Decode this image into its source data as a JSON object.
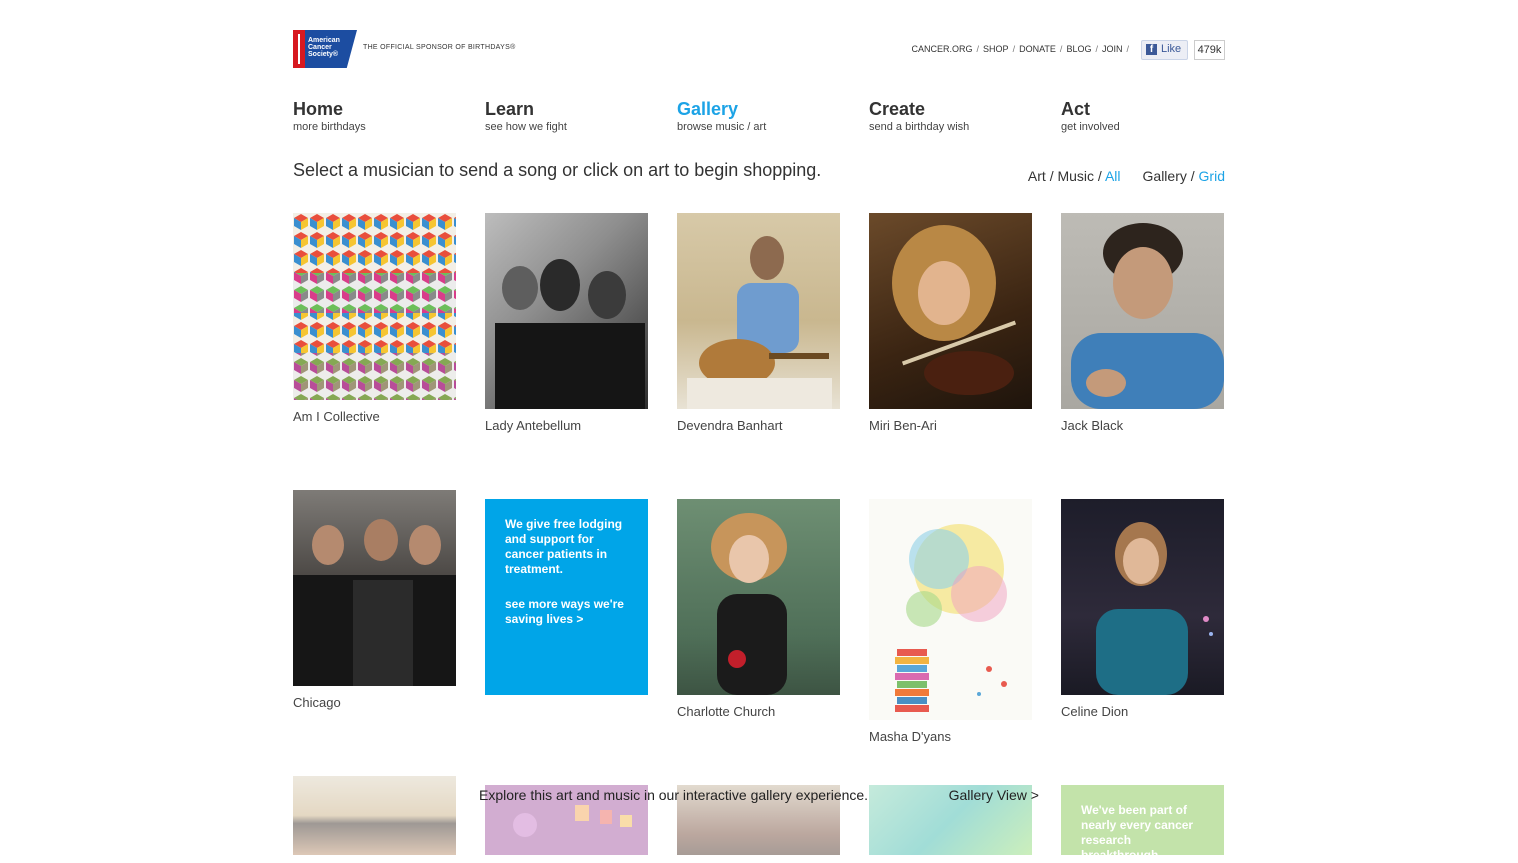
{
  "header": {
    "logo_lines": [
      "American",
      "Cancer",
      "Society®"
    ],
    "tagline": "THE OFFICIAL SPONSOR OF BIRTHDAYS®",
    "links": [
      "CANCER.ORG",
      "SHOP",
      "DONATE",
      "BLOG",
      "JOIN"
    ],
    "like_label": "Like",
    "like_count": "479k"
  },
  "nav": [
    {
      "title": "Home",
      "sub": "more birthdays"
    },
    {
      "title": "Learn",
      "sub": "see how we fight"
    },
    {
      "title": "Gallery",
      "sub": "browse music / art"
    },
    {
      "title": "Create",
      "sub": "send a birthday wish"
    },
    {
      "title": "Act",
      "sub": "get involved"
    }
  ],
  "active_nav": "Gallery",
  "intro": "Select a musician to send a song or click on art to begin shopping.",
  "filters": {
    "art": "Art",
    "music": "Music",
    "all": "All",
    "gallery": "Gallery",
    "grid": "Grid"
  },
  "tiles": [
    {
      "caption": "Am I Collective"
    },
    {
      "caption": "Lady Antebellum"
    },
    {
      "caption": "Devendra Banhart"
    },
    {
      "caption": "Miri Ben-Ari"
    },
    {
      "caption": "Jack Black"
    },
    {
      "caption": "Chicago"
    },
    {
      "caption": "Charlotte Church"
    },
    {
      "caption": "Masha D'yans"
    },
    {
      "caption": "Celine Dion"
    }
  ],
  "promo": {
    "text": "We give free lodging and support for cancer patients in treatment.",
    "link": "see more ways we're saving lives >"
  },
  "promo2": {
    "text": "We've been part of nearly every cancer research breakthrough"
  },
  "footer_bar": {
    "explore": "Explore this art and music in our interactive gallery experience.",
    "gallery_view": "Gallery View >"
  },
  "colors": {
    "accent": "#1ca3e6",
    "promo_blue": "#00a5e8",
    "promo_green": "#7bc043",
    "acs_blue": "#1c4da1",
    "acs_red": "#d71920"
  }
}
